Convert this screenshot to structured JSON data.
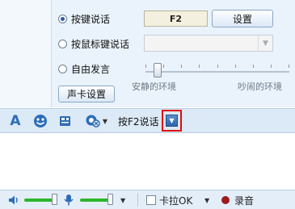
{
  "voice_mode": {
    "options": [
      {
        "label": "按键说话",
        "checked": true
      },
      {
        "label": "按鼠标键说话",
        "checked": false
      },
      {
        "label": "自由发言",
        "checked": false
      }
    ],
    "hotkey_value": "F2",
    "settings_button": "设置",
    "mouse_key_select_value": "",
    "soundcard_button": "声卡设置",
    "environment_slider": {
      "left_label": "安静的环境",
      "right_label": "吵闹的环境",
      "level": 0.08
    }
  },
  "toolbar": {
    "icons": [
      "font-icon",
      "emoji-icon",
      "screenshot-icon",
      "voice-effect-icon"
    ],
    "mode_label": "按F2说话",
    "highlight_color": "#e10c0c"
  },
  "bottom_bar": {
    "speaker_volume_level": 0.75,
    "mic_volume_level": 0.75,
    "karaoke_label": "卡拉OK",
    "karaoke_checked": false,
    "record_label": "录音"
  },
  "colors": {
    "panel_bg": "#eaf3fb",
    "toolbar_bg": "#dce9f6",
    "volume_green": "#2db52d",
    "record_red": "#9b1c1c"
  }
}
